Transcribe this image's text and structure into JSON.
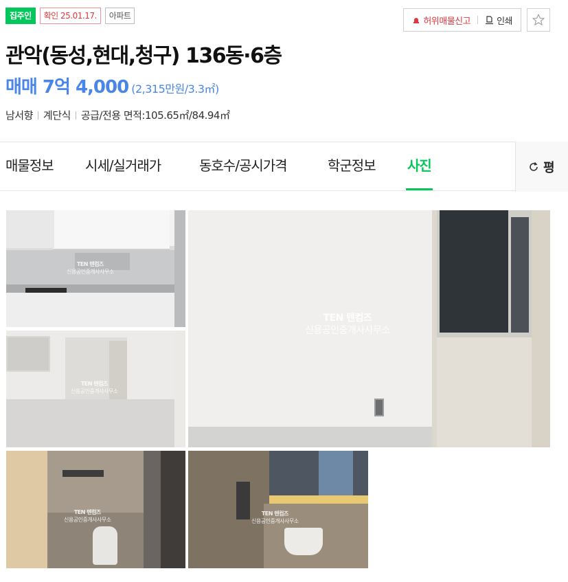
{
  "badges": {
    "owner": "집주인",
    "confirm": "확인 25.01.17.",
    "type": "아파트"
  },
  "utility": {
    "report_label": "허위매물신고",
    "print_label": "인쇄",
    "favorite_icon": "star-icon"
  },
  "listing": {
    "title": "관악(동성,현대,청구) 136동·6층",
    "price": "매매 7억 4,000",
    "price_per_unit": "(2,315만원/3.3㎡)",
    "specs": [
      "남서향",
      "계단식",
      "공급/전용 면적:105.65㎡/84.94㎡"
    ]
  },
  "tabs": [
    {
      "label": "매물정보",
      "active": false
    },
    {
      "label": "시세/실거래가",
      "active": false
    },
    {
      "label": "동호수/공시가격",
      "active": false
    },
    {
      "label": "학군정보",
      "active": false
    },
    {
      "label": "사진",
      "active": true
    }
  ],
  "tab_end": {
    "label": "평",
    "icon": "refresh-icon"
  },
  "watermark": {
    "brand": "TEN 텐컴즈",
    "office": "신용공인중개사사무소"
  },
  "colors": {
    "accent_green": "#03c75a",
    "price_blue": "#4a86e8",
    "report_red": "#e0383e"
  }
}
